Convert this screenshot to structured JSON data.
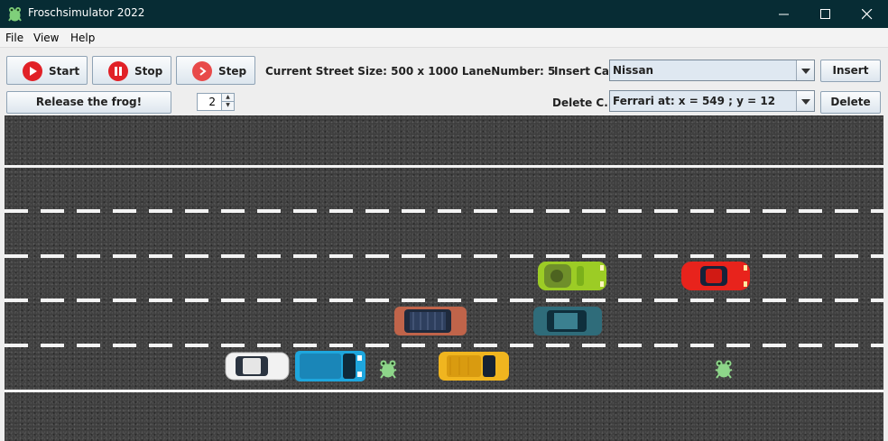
{
  "window": {
    "title": "Froschsimulator 2022",
    "icon": "frog-icon",
    "controls": [
      "minimize-icon",
      "maximize-icon",
      "close-icon"
    ]
  },
  "menu": [
    "File",
    "View",
    "Help"
  ],
  "toolbar": {
    "start_label": "Start",
    "stop_label": "Stop",
    "step_label": "Step",
    "street_info": "Current Street Size:  500 x 1000 LaneNumber: 5",
    "release_label": "Release the frog!",
    "frog_count": "2",
    "insert_car_label": "Insert Car",
    "insert_car_value": "Nissan",
    "insert_button": "Insert",
    "delete_car_label": "Delete C...",
    "delete_car_value": "Ferrari at: x = 549 ; y = 12",
    "delete_button": "Delete"
  },
  "road": {
    "lanes": 5,
    "cars": [
      {
        "color": "#9ccc25",
        "kind": "convertible"
      },
      {
        "color": "#e8231c",
        "kind": "sports"
      },
      {
        "color": "#c0644a",
        "kind": "suv"
      },
      {
        "color": "#2f6c7a",
        "kind": "hatchback"
      },
      {
        "color": "#f2f2f2",
        "kind": "sedan"
      },
      {
        "color": "#1ea6dd",
        "kind": "van"
      },
      {
        "color": "#f0b51f",
        "kind": "wagon"
      }
    ],
    "frogs": 2
  }
}
